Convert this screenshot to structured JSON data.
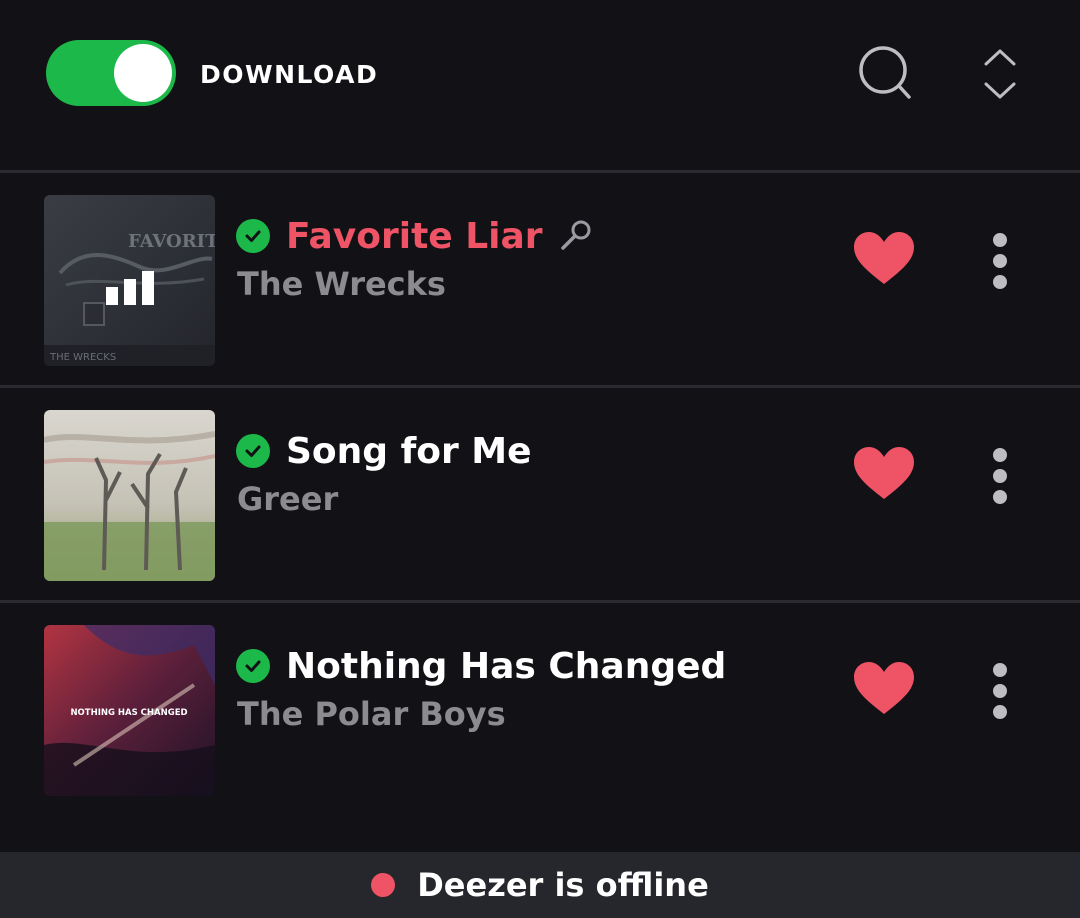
{
  "header": {
    "download_label": "DOWNLOAD",
    "download_enabled": true,
    "icons": {
      "search": "search-icon",
      "sort": "sort-icon"
    }
  },
  "tracks": [
    {
      "title": "Favorite Liar",
      "artist": "The Wrecks",
      "downloaded": true,
      "now_playing": true,
      "lyrics": true,
      "liked": true,
      "cover_text": "FAVORITE",
      "cover_subtext": "THE WRECKS"
    },
    {
      "title": "Song for Me",
      "artist": "Greer",
      "downloaded": true,
      "now_playing": false,
      "lyrics": false,
      "liked": true
    },
    {
      "title": "Nothing Has Changed",
      "artist": "The Polar Boys",
      "downloaded": true,
      "now_playing": false,
      "lyrics": false,
      "liked": true,
      "cover_text": "NOTHING HAS CHANGED"
    }
  ],
  "status": {
    "text": "Deezer is offline"
  },
  "colors": {
    "accent_green": "#1db84a",
    "accent_red": "#ef5466",
    "background": "#121216",
    "banner": "#26262d",
    "muted_text": "#8b8b90"
  }
}
